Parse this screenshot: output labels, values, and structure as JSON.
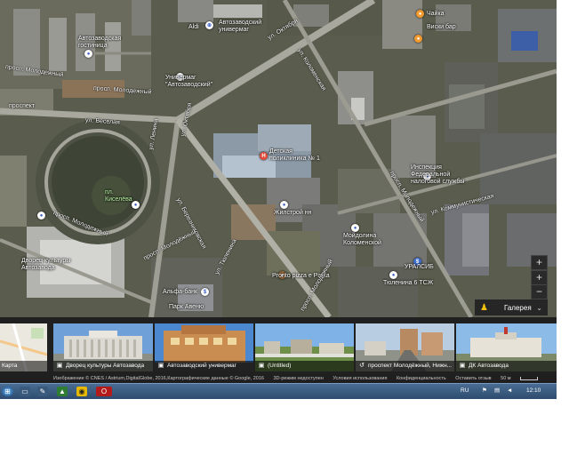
{
  "map": {
    "labels": {
      "aldi": "Aldi",
      "avtozavodskoy_univermag": "Автозаводский универмаг",
      "chayka": "Чайка",
      "viski_bar": "Виски бар",
      "avtozavodskaya_gostinitsa": "Автозаводская гостиница",
      "univermag_avtozavodskoy": "Универмаг \"Автозаводский\"",
      "pr_molodezhny_1": "просп. Молодежный",
      "pr_molodezhny_2": "просп. Молодежный",
      "prospekt": "проспект",
      "ploshchad": "пл. Киселёва",
      "detskaya_poliklinika": "Детская поликлиника № 1",
      "inspektsiya": "Инспекция Федеральной налоговой службы",
      "zhilstroy": "Жилстрой нн",
      "mojdolina": "Мойдолина Коломенской",
      "uralsib": "УРАЛСИБ",
      "tyulenina": "Тюленина 6 ТСЖ",
      "pronto": "Pronto pizza e Pasta",
      "dvorets_kultury": "Дворец культуры Автозавода",
      "alfa_bank": "Альфа-банк",
      "park_avenue": "Парк Авеню"
    },
    "streets": {
      "oktyabrya_1": "ул. Октября",
      "oktyabrya_2": "ул. Октября",
      "molodezhnyi_right": "просп. Молодежный",
      "molodezhnyi_lower": "просп. Молодежный",
      "bereznikovskaya": "ул. Березниковская",
      "molodeznyj_top": "просп. Молодежный",
      "kolomenskaya": "ул. Коломенская",
      "kommunisticheskaya": "ул. Коммунистическая",
      "molodezhnyi_diag": "просп. Молодёжный",
      "lenina": "ул. Ленина",
      "tyulenina": "ул. Тюленина",
      "veselaya": "ул. Веселая"
    },
    "zoom": {
      "in": "+",
      "out": "−",
      "fullscreen": "+"
    }
  },
  "gallery": {
    "label": "Галерея",
    "toggle": "⌄"
  },
  "thumbnails": [
    {
      "caption": "Карта"
    },
    {
      "caption": "Дворец культуры Автозавода",
      "icon": "camera-icon"
    },
    {
      "caption": "Автозаводский универмаг",
      "icon": "camera-icon"
    },
    {
      "caption": "(Untitled)",
      "icon": "camera-icon"
    },
    {
      "caption": "проспект Молодёжный, Нижн...",
      "icon": "streetview-icon"
    },
    {
      "caption": "ДК Автозавода",
      "icon": "camera-icon"
    }
  ],
  "footer": {
    "imagery": "Изображение © CNES / Astrium,DigitalGlobe, 2016,Картографические данные © Google, 2016",
    "mode3d": "3D-режим недоступен",
    "terms": "Условия использования",
    "privacy": "Конфиденциальность",
    "feedback": "Оставить отзыв",
    "scale": "50 м"
  },
  "taskbar": {
    "lang": "RU",
    "time": "12:10"
  }
}
